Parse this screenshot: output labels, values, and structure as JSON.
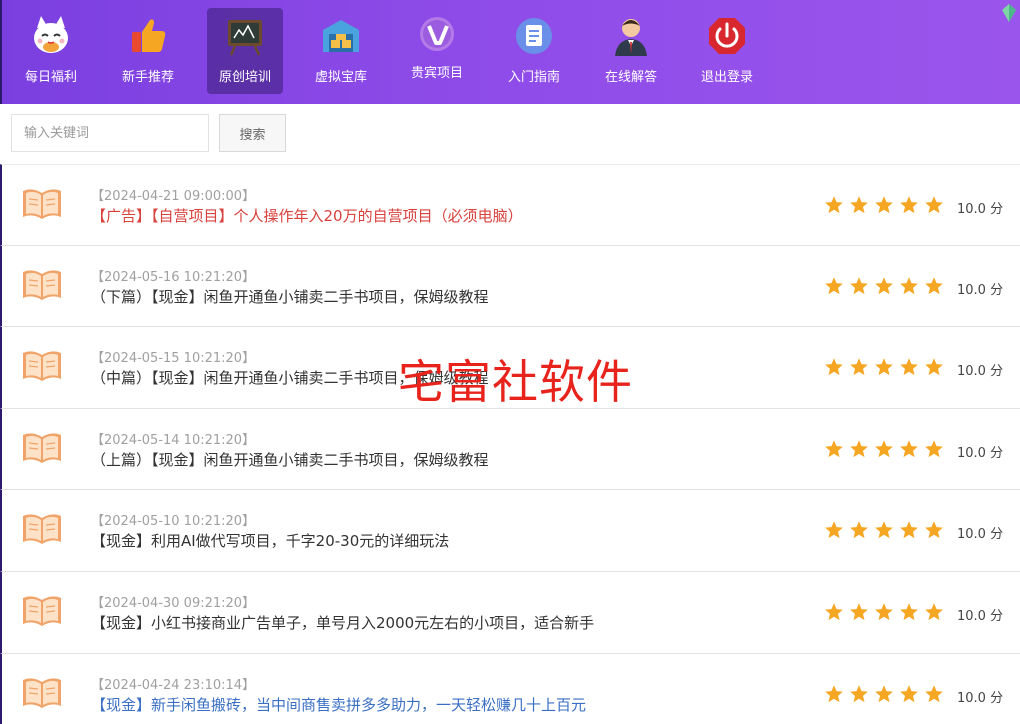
{
  "nav": {
    "items": [
      {
        "label": "每日福利",
        "icon": "lucky-cat-icon",
        "active": false
      },
      {
        "label": "新手推荐",
        "icon": "thumbs-up-icon",
        "active": false
      },
      {
        "label": "原创培训",
        "icon": "blackboard-icon",
        "active": true
      },
      {
        "label": "虚拟宝库",
        "icon": "warehouse-icon",
        "active": false
      },
      {
        "label": "贵宾项目",
        "icon": "vip-badge-icon",
        "active": false
      },
      {
        "label": "入门指南",
        "icon": "guide-document-icon",
        "active": false
      },
      {
        "label": "在线解答",
        "icon": "support-agent-icon",
        "active": false
      },
      {
        "label": "退出登录",
        "icon": "power-icon",
        "active": false
      }
    ]
  },
  "search": {
    "placeholder": "输入关键词",
    "value": "",
    "button_label": "搜索"
  },
  "list": {
    "items": [
      {
        "date": "【2024-04-21 09:00:00】",
        "title": "【广告】【自营项目】个人操作年入20万的自营项目（必须电脑）",
        "title_color": "red",
        "rating_stars": 5,
        "score": "10.0 分"
      },
      {
        "date": "【2024-05-16 10:21:20】",
        "title": "（下篇）【现金】闲鱼开通鱼小铺卖二手书项目，保姆级教程",
        "title_color": "default",
        "rating_stars": 5,
        "score": "10.0 分"
      },
      {
        "date": "【2024-05-15 10:21:20】",
        "title": "（中篇）【现金】闲鱼开通鱼小铺卖二手书项目，保姆级教程",
        "title_color": "default",
        "rating_stars": 5,
        "score": "10.0 分"
      },
      {
        "date": "【2024-05-14 10:21:20】",
        "title": "（上篇）【现金】闲鱼开通鱼小铺卖二手书项目，保姆级教程",
        "title_color": "default",
        "rating_stars": 5,
        "score": "10.0 分"
      },
      {
        "date": "【2024-05-10 10:21:20】",
        "title": "【现金】利用AI做代写项目，千字20-30元的详细玩法",
        "title_color": "default",
        "rating_stars": 5,
        "score": "10.0 分"
      },
      {
        "date": "【2024-04-30 09:21:20】",
        "title": "【现金】小红书接商业广告单子，单号月入2000元左右的小项目，适合新手",
        "title_color": "default",
        "rating_stars": 5,
        "score": "10.0 分"
      },
      {
        "date": "【2024-04-24 23:10:14】",
        "title": "【现金】新手闲鱼搬砖，当中间商售卖拼多多助力，一天轻松赚几十上百元",
        "title_color": "blue",
        "rating_stars": 5,
        "score": "10.0 分"
      }
    ]
  },
  "watermark": "宅富社软件",
  "colors": {
    "nav_gradient_start": "#7b3fe0",
    "nav_gradient_end": "#9a55ec",
    "star": "#f5a623",
    "ad_title": "#d9413c",
    "blue_title": "#3a6fc4",
    "watermark": "#e8231c"
  }
}
